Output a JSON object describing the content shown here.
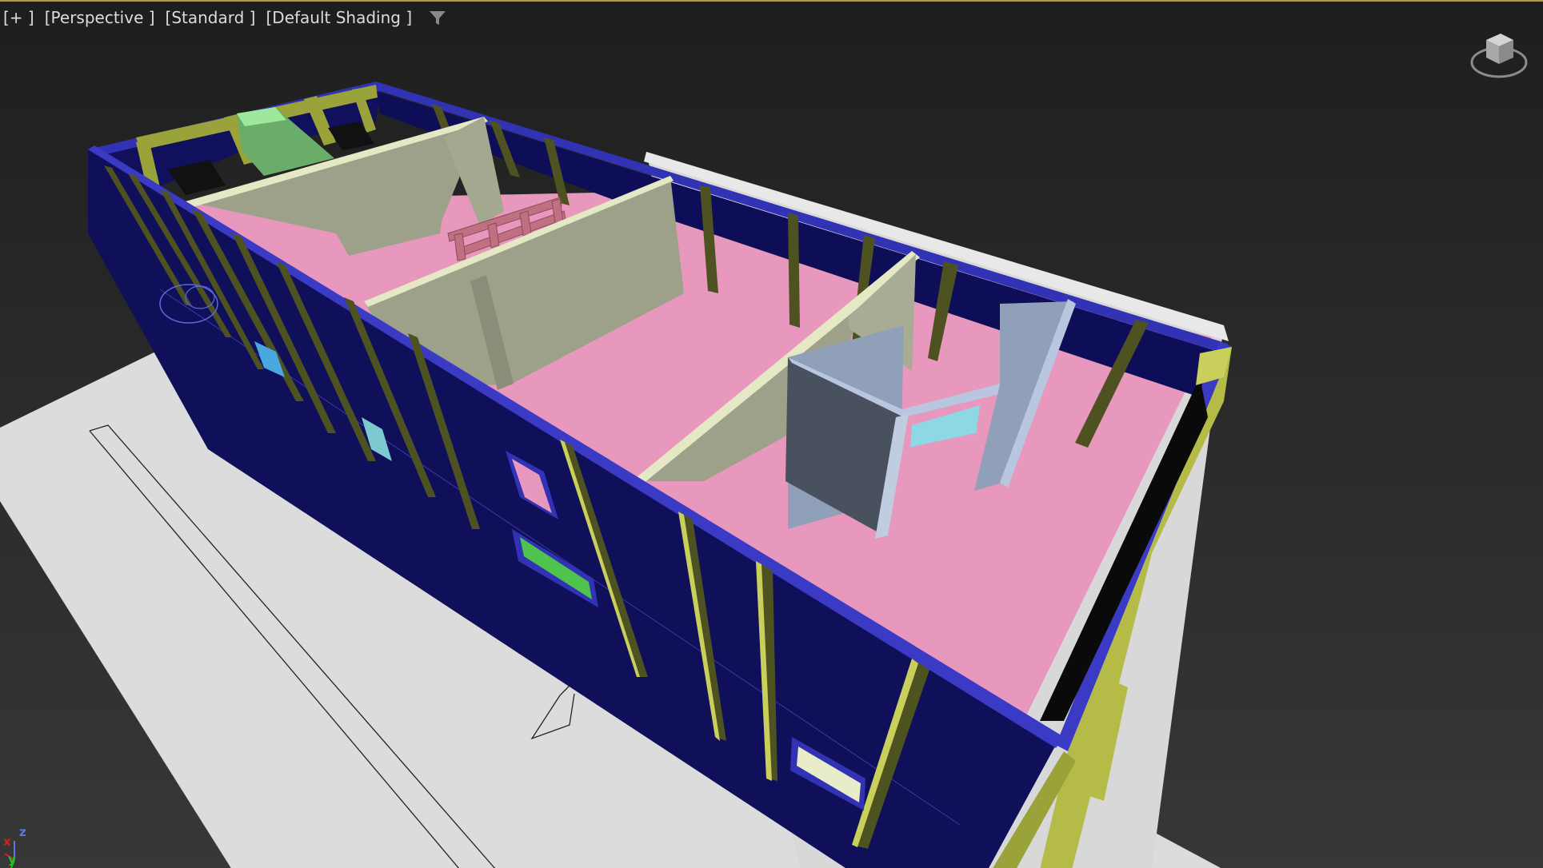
{
  "viewport": {
    "labels": {
      "plus": "[+ ]",
      "view": "[Perspective ]",
      "mode": "[Standard ]",
      "shading": "[Default Shading ]"
    },
    "filter_icon": "filter-funnel-icon",
    "viewcube_icon": "viewcube-icon",
    "axes": {
      "x": "x",
      "y": "y",
      "z": "z"
    }
  },
  "colors": {
    "background": "#2a2a2a",
    "wall_exterior": "#10105c",
    "wall_top_edge": "#3434b8",
    "stud": "#4d5220",
    "stud_highlight": "#c8cf5a",
    "floor": "#e896bc",
    "partition": "#9da18a",
    "partition_top": "#e4e8c4",
    "ground_plane": "#dedede",
    "glass": "#8cd8e4",
    "box_green": "#6aad6a",
    "shower": "#4a515e",
    "axis_x": "#d02020",
    "axis_y": "#20c020",
    "axis_z": "#5a78e0"
  }
}
